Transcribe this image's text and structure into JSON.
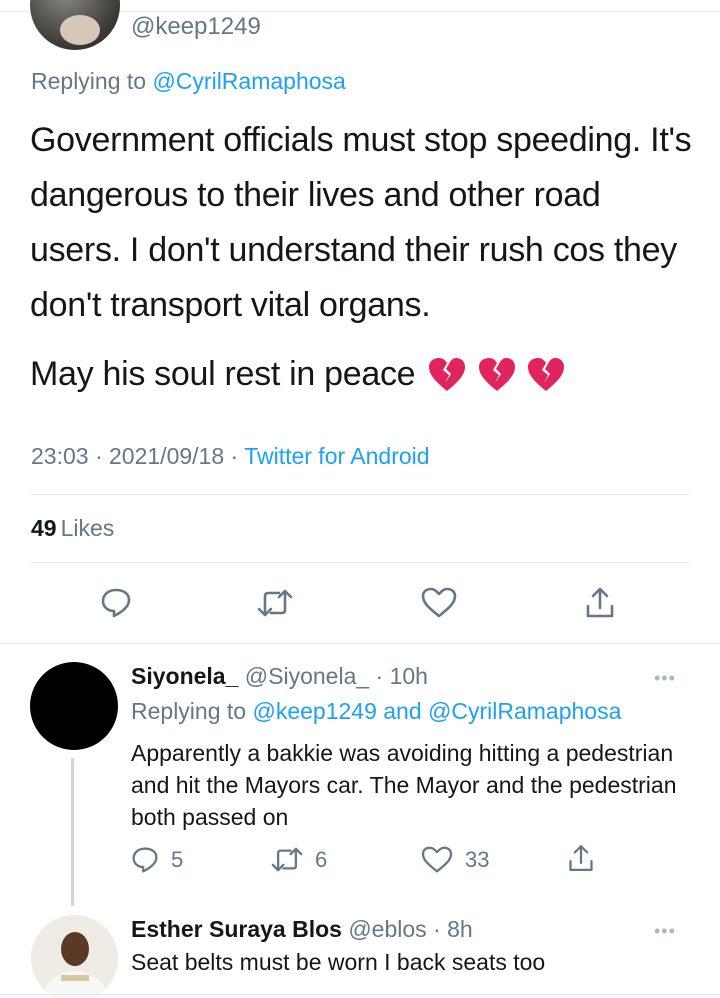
{
  "main_tweet": {
    "handle": "@keep1249",
    "replying_prefix": "Replying to",
    "replying_to": "@CyrilRamaphosa",
    "paragraph1": "Government officials must stop speeding. It's dangerous to their lives and other road users. I don't understand their rush cos they don't transport vital organs.",
    "paragraph2": "May his soul rest in peace",
    "emoji_count": 3,
    "time": "23:03",
    "separator": "·",
    "date": "2021/09/18",
    "source": "Twitter for Android",
    "likes_count": "49",
    "likes_label": "Likes"
  },
  "replies": [
    {
      "name": "Siyonela_",
      "handle": "@Siyonela_",
      "time": "· 10h",
      "replying_prefix": "Replying to",
      "replying_to_1": "@keep1249",
      "replying_and": "and",
      "replying_to_2": "@CyrilRamaphosa",
      "text": "Apparently a bakkie was avoiding hitting a pedestrian and hit the Mayors car. The Mayor and the pedestrian both passed on",
      "reply_count": "5",
      "retweet_count": "6",
      "like_count": "33",
      "more": "•••"
    },
    {
      "name": "Esther Suraya Blos",
      "handle": "@eblos",
      "time": "· 8h",
      "text": "Seat belts must be worn I back seats too",
      "more": "•••"
    }
  ],
  "colors": {
    "accent": "#1da1f2",
    "muted": "#657786",
    "text": "#14171a",
    "divider": "#e1e8ed",
    "broken_heart": "#e0245e"
  },
  "icons": [
    "reply-icon",
    "retweet-icon",
    "like-icon",
    "share-icon",
    "broken-heart-icon",
    "more-icon"
  ]
}
